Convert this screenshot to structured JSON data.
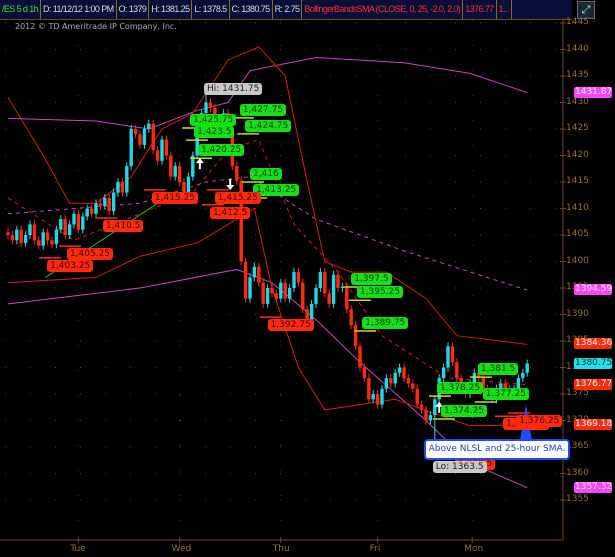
{
  "header": {
    "symbol": "/ES 5 d 1h",
    "date": "D: 11/12/12 1:00 PM",
    "open": "O: 1379",
    "high": "H: 1381.25",
    "low": "L: 1378.5",
    "close": "C: 1380.75",
    "range": "R: 2.75",
    "study": "BollingerBandsSMA (CLOSE, 0, 25, -2.0, 2.0)",
    "study_value": "1376.77",
    "more": "1..."
  },
  "copyright": "2012 © TD Ameritrade IP Company, Inc.",
  "callout": "Above NLSL and 25-hour SMA.",
  "chart_data": {
    "type": "candlestick",
    "timeframe": "1h",
    "ylim": [
      1352,
      1447
    ],
    "y_ticks": [
      1445,
      1440,
      1435,
      1430,
      1425,
      1420,
      1415,
      1410,
      1405,
      1400,
      1395,
      1390,
      1385,
      1380,
      1375,
      1370,
      1365,
      1360,
      1355
    ],
    "x_day_labels": [
      {
        "label": "Tue",
        "index": 16
      },
      {
        "label": "Wed",
        "index": 39
      },
      {
        "label": "Thu",
        "index": 62
      },
      {
        "label": "Fri",
        "index": 84
      },
      {
        "label": "Mon",
        "index": 105.5
      }
    ],
    "closes": [
      1405,
      1404,
      1406,
      1403.5,
      1405,
      1407,
      1404,
      1403,
      1405.5,
      1404,
      1403.25,
      1406,
      1408,
      1405,
      1407,
      1409,
      1406,
      1408.5,
      1410,
      1409,
      1411,
      1410.5,
      1412,
      1409.5,
      1413,
      1415,
      1413,
      1418,
      1425,
      1424,
      1422,
      1425,
      1426,
      1421,
      1419,
      1423,
      1420,
      1416,
      1418,
      1415,
      1412.5,
      1416,
      1420,
      1424,
      1428,
      1430,
      1429,
      1427,
      1426,
      1428,
      1425,
      1418,
      1415.25,
      1400,
      1393,
      1397,
      1399,
      1396,
      1392,
      1395,
      1394,
      1393,
      1396,
      1393,
      1395,
      1398,
      1396,
      1391,
      1389,
      1392,
      1395,
      1398,
      1394,
      1392,
      1397.5,
      1395,
      1395.25,
      1391,
      1388,
      1384,
      1380,
      1378,
      1374,
      1375,
      1373,
      1376,
      1378,
      1377,
      1379,
      1380,
      1378,
      1377,
      1376,
      1373,
      1372,
      1370,
      1371,
      1374,
      1378,
      1380,
      1384,
      1381,
      1378,
      1376,
      1375,
      1377,
      1379,
      1378,
      1376,
      1375,
      1374,
      1376,
      1377,
      1376,
      1375,
      1376,
      1378,
      1379,
      1380.75
    ],
    "first_open": 1405.5,
    "extremes": [
      {
        "label": "Hi: 1431.75",
        "index": 45,
        "price": 1431.75,
        "type": "high"
      },
      {
        "label": "Lo: 1363.5",
        "index": 97,
        "price": 1363.5,
        "type": "low"
      }
    ],
    "series": [
      {
        "name": "SMA band upper",
        "color": "#d040d0",
        "style": "solid",
        "last": "1431.87",
        "points": [
          [
            0,
            1427
          ],
          [
            20,
            1426.5
          ],
          [
            32,
            1425
          ],
          [
            43,
            1428.5
          ],
          [
            50,
            1430
          ],
          [
            55,
            1436
          ],
          [
            70,
            1438.5
          ],
          [
            90,
            1437.5
          ],
          [
            105,
            1435.5
          ],
          [
            118,
            1431.87
          ]
        ]
      },
      {
        "name": "SMA midline",
        "color": "#d040d0",
        "style": "dashed",
        "last": "1394.59",
        "points": [
          [
            0,
            1409
          ],
          [
            30,
            1411
          ],
          [
            45,
            1415
          ],
          [
            55,
            1416
          ],
          [
            70,
            1408
          ],
          [
            90,
            1402
          ],
          [
            118,
            1394.59
          ]
        ]
      },
      {
        "name": "SMA band lower",
        "color": "#d040d0",
        "style": "solid",
        "last": "1357.32",
        "points": [
          [
            0,
            1392
          ],
          [
            30,
            1395
          ],
          [
            52,
            1398.5
          ],
          [
            60,
            1396
          ],
          [
            70,
            1389
          ],
          [
            80,
            1381
          ],
          [
            95,
            1370
          ],
          [
            105,
            1362
          ],
          [
            118,
            1357.32
          ]
        ]
      },
      {
        "name": "BollingerBands upper",
        "color": "#e01a0a",
        "style": "solid",
        "last": "1384.36",
        "points": [
          [
            0,
            1431
          ],
          [
            8,
            1420
          ],
          [
            14,
            1411
          ],
          [
            20,
            1411
          ],
          [
            28,
            1416
          ],
          [
            35,
            1425
          ],
          [
            42,
            1428
          ],
          [
            50,
            1438
          ],
          [
            57,
            1440.5
          ],
          [
            63,
            1435
          ],
          [
            68,
            1415
          ],
          [
            72,
            1400
          ],
          [
            78,
            1398
          ],
          [
            86,
            1398
          ],
          [
            95,
            1393
          ],
          [
            102,
            1386
          ],
          [
            118,
            1384.36
          ]
        ]
      },
      {
        "name": "BollingerBands midline",
        "color": "#e01a0a",
        "style": "dashed",
        "last": "1376.77",
        "points": [
          [
            0,
            1412
          ],
          [
            15,
            1404
          ],
          [
            30,
            1409
          ],
          [
            42,
            1413
          ],
          [
            50,
            1421
          ],
          [
            57,
            1423
          ],
          [
            65,
            1407
          ],
          [
            75,
            1398
          ],
          [
            85,
            1386
          ],
          [
            100,
            1378
          ],
          [
            118,
            1376.77
          ]
        ]
      },
      {
        "name": "BollingerBands lower",
        "color": "#e01a0a",
        "style": "solid",
        "last": "1369.18",
        "points": [
          [
            0,
            1396
          ],
          [
            20,
            1397
          ],
          [
            30,
            1401
          ],
          [
            43,
            1403.5
          ],
          [
            50,
            1407
          ],
          [
            56,
            1410
          ],
          [
            60,
            1395
          ],
          [
            66,
            1380
          ],
          [
            72,
            1372
          ],
          [
            80,
            1373
          ],
          [
            88,
            1374
          ],
          [
            98,
            1371
          ],
          [
            105,
            1369
          ],
          [
            118,
            1369.18
          ]
        ]
      }
    ],
    "last_price": "1380.75",
    "trendline": [
      [
        8.5,
        1397
      ],
      [
        34,
        1411
      ]
    ],
    "price_labels": [
      {
        "text": "1,403.25",
        "color": "red",
        "index": 8.9,
        "price": 1399.2
      },
      {
        "text": "1,405.25",
        "color": "red",
        "index": 13.4,
        "price": 1401.4
      },
      {
        "text": "1,410.5",
        "color": "red",
        "index": 21.6,
        "price": 1406.7
      },
      {
        "text": "1,415.25",
        "color": "red",
        "index": 32.7,
        "price": 1412
      },
      {
        "text": "1,425.75",
        "color": "green",
        "index": 41.4,
        "price": 1426.7
      },
      {
        "text": "1,423.5",
        "color": "green",
        "index": 42.3,
        "price": 1424.4
      },
      {
        "text": "1,420.25",
        "color": "green",
        "index": 43.2,
        "price": 1421
      },
      {
        "text": "1,427.75",
        "color": "green",
        "index": 52.7,
        "price": 1428.6
      },
      {
        "text": "1,424.75",
        "color": "green",
        "index": 53.9,
        "price": 1425.6
      },
      {
        "text": "1,416",
        "color": "green",
        "index": 55,
        "price": 1416.5
      },
      {
        "text": "1,413.25",
        "color": "green",
        "index": 55.7,
        "price": 1413.5
      },
      {
        "text": "1,415.25",
        "color": "red",
        "index": 47,
        "price": 1412
      },
      {
        "text": "1,412.5",
        "color": "red",
        "index": 45.9,
        "price": 1409.2
      },
      {
        "text": "1,392.75",
        "color": "red",
        "index": 59,
        "price": 1388
      },
      {
        "text": "1,397.5",
        "color": "green",
        "index": 78,
        "price": 1396.7
      },
      {
        "text": "1,395.25",
        "color": "green",
        "index": 79.3,
        "price": 1394.2
      },
      {
        "text": "1,389.75",
        "color": "green",
        "index": 80.5,
        "price": 1388.4
      },
      {
        "text": "1,381.5",
        "color": "green",
        "index": 106.8,
        "price": 1379.7
      },
      {
        "text": "1,378.25",
        "color": "green",
        "index": 97.5,
        "price": 1376.1
      },
      {
        "text": "1,377.25",
        "color": "green",
        "index": 107.9,
        "price": 1375
      },
      {
        "text": "1,374.25",
        "color": "green",
        "index": 98.4,
        "price": 1371.8
      },
      {
        "text": "1,375.25",
        "color": "red",
        "index": 112.5,
        "price": 1369.3
      },
      {
        "text": "1,376.25",
        "color": "red",
        "index": 115.5,
        "price": 1369.9
      },
      {
        "text": "1,368.5",
        "color": "red",
        "index": 101.6,
        "price": 1361.8
      }
    ],
    "signals": [
      {
        "dir": "up",
        "index": 43.6,
        "price": 1418
      },
      {
        "dir": "down",
        "index": 50.5,
        "price": 1415
      },
      {
        "dir": "up",
        "index": 98,
        "price": 1372
      },
      {
        "dir": "down",
        "index": 105.5,
        "price": 1372
      },
      {
        "dir": "up",
        "index": 110,
        "price": 1374.5
      },
      {
        "dir": "down",
        "index": 114.3,
        "price": 1375.5
      }
    ]
  }
}
